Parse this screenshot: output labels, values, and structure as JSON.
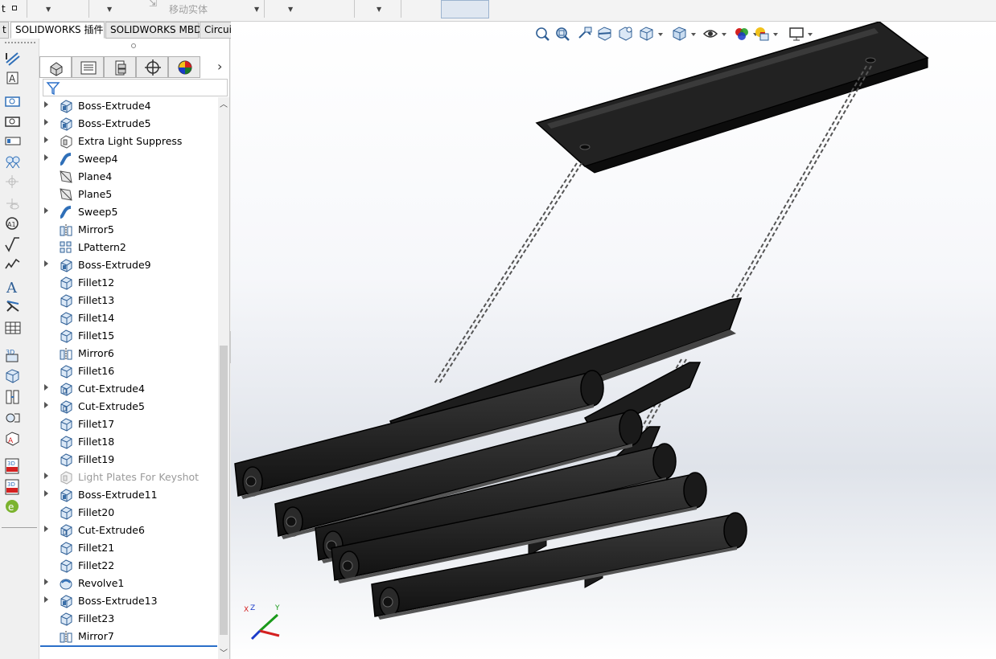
{
  "toolbar": {
    "move_body_label": "移动实体",
    "partial_left_label": "t"
  },
  "tabs": [
    {
      "label": "SOLIDWORKS 插件"
    },
    {
      "label": "SOLIDWORKS MBD"
    },
    {
      "label": "CircuitWorks"
    }
  ],
  "left_commands": [
    {
      "icon": "smart-dimension-icon"
    },
    {
      "icon": "note-icon"
    },
    {
      "icon": "linear-dimension-icon"
    },
    {
      "icon": "ordinate-dimension-icon"
    },
    {
      "icon": "balloon-icon"
    },
    {
      "icon": "auto-balloon-icon"
    },
    {
      "icon": "center-mark-icon"
    },
    {
      "icon": "datum-target-icon"
    },
    {
      "icon": "weld-symbol-icon"
    },
    {
      "icon": "surface-finish-icon"
    },
    {
      "icon": "geometric-tolerance-icon"
    },
    {
      "icon": "annotation-text-icon"
    },
    {
      "icon": "datum-feature-icon"
    },
    {
      "icon": "table-icon"
    },
    {
      "icon": "3d-view-icon"
    },
    {
      "icon": "capture-view-icon"
    },
    {
      "icon": "dimxpert-icon"
    },
    {
      "icon": "tolerance-status-icon"
    },
    {
      "icon": "show-tolerance-icon"
    },
    {
      "icon": "publish-3d-pdf-icon"
    },
    {
      "icon": "3d-pdf-template-icon"
    },
    {
      "icon": "edrawings-icon"
    }
  ],
  "feature_tree": [
    {
      "label": "Boss-Extrude4",
      "type": "extrude",
      "expandable": true
    },
    {
      "label": "Boss-Extrude5",
      "type": "extrude",
      "expandable": true
    },
    {
      "label": "Extra Light Suppress",
      "type": "folder",
      "expandable": true
    },
    {
      "label": "Sweep4",
      "type": "sweep",
      "expandable": true
    },
    {
      "label": "Plane4",
      "type": "plane",
      "expandable": false
    },
    {
      "label": "Plane5",
      "type": "plane",
      "expandable": false
    },
    {
      "label": "Sweep5",
      "type": "sweep",
      "expandable": true
    },
    {
      "label": "Mirror5",
      "type": "mirror",
      "expandable": false
    },
    {
      "label": "LPattern2",
      "type": "pattern",
      "expandable": false
    },
    {
      "label": "Boss-Extrude9",
      "type": "extrude",
      "expandable": true
    },
    {
      "label": "Fillet12",
      "type": "fillet",
      "expandable": false
    },
    {
      "label": "Fillet13",
      "type": "fillet",
      "expandable": false
    },
    {
      "label": "Fillet14",
      "type": "fillet",
      "expandable": false
    },
    {
      "label": "Fillet15",
      "type": "fillet",
      "expandable": false
    },
    {
      "label": "Mirror6",
      "type": "mirror",
      "expandable": false
    },
    {
      "label": "Fillet16",
      "type": "fillet",
      "expandable": false
    },
    {
      "label": "Cut-Extrude4",
      "type": "cut",
      "expandable": true
    },
    {
      "label": "Cut-Extrude5",
      "type": "cut",
      "expandable": true
    },
    {
      "label": "Fillet17",
      "type": "fillet",
      "expandable": false
    },
    {
      "label": "Fillet18",
      "type": "fillet",
      "expandable": false
    },
    {
      "label": "Fillet19",
      "type": "fillet",
      "expandable": false
    },
    {
      "label": "Light Plates For Keyshot",
      "type": "folder-suppressed",
      "expandable": true
    },
    {
      "label": "Boss-Extrude11",
      "type": "extrude",
      "expandable": true
    },
    {
      "label": "Fillet20",
      "type": "fillet",
      "expandable": false
    },
    {
      "label": "Cut-Extrude6",
      "type": "cut",
      "expandable": true
    },
    {
      "label": "Fillet21",
      "type": "fillet",
      "expandable": false
    },
    {
      "label": "Fillet22",
      "type": "fillet",
      "expandable": false
    },
    {
      "label": "Revolve1",
      "type": "revolve",
      "expandable": true
    },
    {
      "label": "Boss-Extrude13",
      "type": "extrude",
      "expandable": true
    },
    {
      "label": "Fillet23",
      "type": "fillet",
      "expandable": false
    },
    {
      "label": "Mirror7",
      "type": "mirror",
      "expandable": false
    }
  ],
  "fm_tabs": [
    "feature-manager-tab-icon",
    "property-manager-tab-icon",
    "configuration-manager-tab-icon",
    "dimxpert-manager-tab-icon",
    "display-manager-tab-icon"
  ],
  "heads_up": [
    "zoom-to-fit-icon",
    "zoom-to-area-icon",
    "previous-view-icon",
    "section-view-icon",
    "dynamic-annotation-icon",
    "view-orientation-icon",
    "display-style-icon",
    "hide-show-icon",
    "edit-appearance-icon",
    "apply-scene-icon",
    "view-settings-icon"
  ],
  "colors": {
    "tree_icon_blue": "#3a6ea8",
    "selection_blue": "#2a6fc9",
    "model_black": "#1c1c1c",
    "model_edge": "#000000",
    "triad_x": "#d42020",
    "triad_y": "#1a9a1a",
    "triad_z": "#1a3ac9"
  }
}
